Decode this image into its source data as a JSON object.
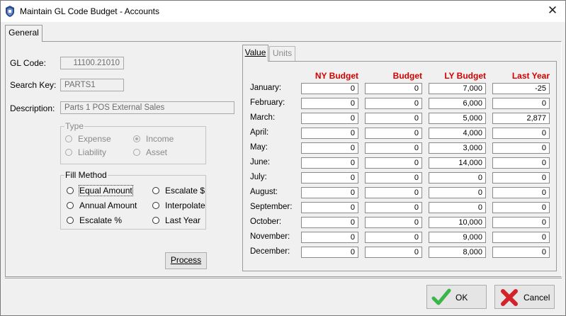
{
  "window": {
    "title": "Maintain GL Code Budget - Accounts",
    "close_glyph": "✕"
  },
  "tabs": {
    "general": "General",
    "value": "Value",
    "units": "Units"
  },
  "general": {
    "gl_code_label": "GL Code:",
    "gl_code_value": "11100.21010",
    "search_key_label": "Search Key:",
    "search_key_value": "PARTS1",
    "description_label": "Description:",
    "description_value": "Parts 1 POS External Sales",
    "type": {
      "legend": "Type",
      "expense": "Expense",
      "income": "Income",
      "liability": "Liability",
      "asset": "Asset",
      "selected": "Income"
    },
    "fill_method": {
      "legend": "Fill Method",
      "equal_amount": "Equal Amount",
      "escalate_dollar": "Escalate $",
      "annual_amount": "Annual Amount",
      "interpolate": "Interpolate",
      "escalate_pct": "Escalate %",
      "last_year": "Last Year"
    },
    "process_button": "Process"
  },
  "budget": {
    "headers": [
      "NY Budget",
      "Budget",
      "LY Budget",
      "Last Year"
    ],
    "months": [
      "January:",
      "February:",
      "March:",
      "April:",
      "May:",
      "June:",
      "July:",
      "August:",
      "September:",
      "October:",
      "November:",
      "December:"
    ],
    "rows": [
      [
        "0",
        "0",
        "7,000",
        "-25"
      ],
      [
        "0",
        "0",
        "6,000",
        "0"
      ],
      [
        "0",
        "0",
        "5,000",
        "2,877"
      ],
      [
        "0",
        "0",
        "4,000",
        "0"
      ],
      [
        "0",
        "0",
        "3,000",
        "0"
      ],
      [
        "0",
        "0",
        "14,000",
        "0"
      ],
      [
        "0",
        "0",
        "0",
        "0"
      ],
      [
        "0",
        "0",
        "0",
        "0"
      ],
      [
        "0",
        "0",
        "0",
        "0"
      ],
      [
        "0",
        "0",
        "10,000",
        "0"
      ],
      [
        "0",
        "0",
        "9,000",
        "0"
      ],
      [
        "0",
        "0",
        "8,000",
        "0"
      ]
    ],
    "header_color": "#d40000"
  },
  "footer": {
    "ok_label": "OK",
    "cancel_label": "Cancel"
  },
  "icons": {
    "app": "app-shield-icon",
    "ok": "checkmark-icon",
    "cancel": "x-cross-icon"
  }
}
